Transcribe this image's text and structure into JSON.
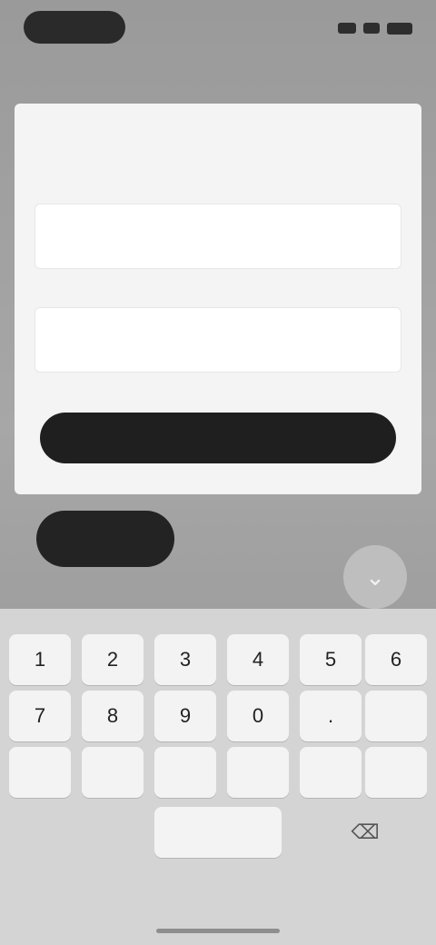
{
  "status_bar": {
    "time": "",
    "icons": [
      "signal-icon",
      "wifi-icon",
      "battery-icon"
    ]
  },
  "header": {
    "title": ""
  },
  "modal": {
    "title": "",
    "amount_label": "",
    "amount_value": "",
    "pin_label": "",
    "pin_value": "",
    "primary_button": ""
  },
  "actions": {
    "secondary_button": "",
    "round_button_icon": "chevron-icon"
  },
  "keypad": {
    "keys": [
      "1",
      "2",
      "3",
      "4",
      "5",
      "6",
      "7",
      "8",
      "9",
      "0",
      "."
    ],
    "backspace_icon": "backspace-icon"
  },
  "colors": {
    "modal_background": "#f4f4f4",
    "button_dark": "#1f1f1f",
    "keypad_background": "#d4d4d4"
  }
}
